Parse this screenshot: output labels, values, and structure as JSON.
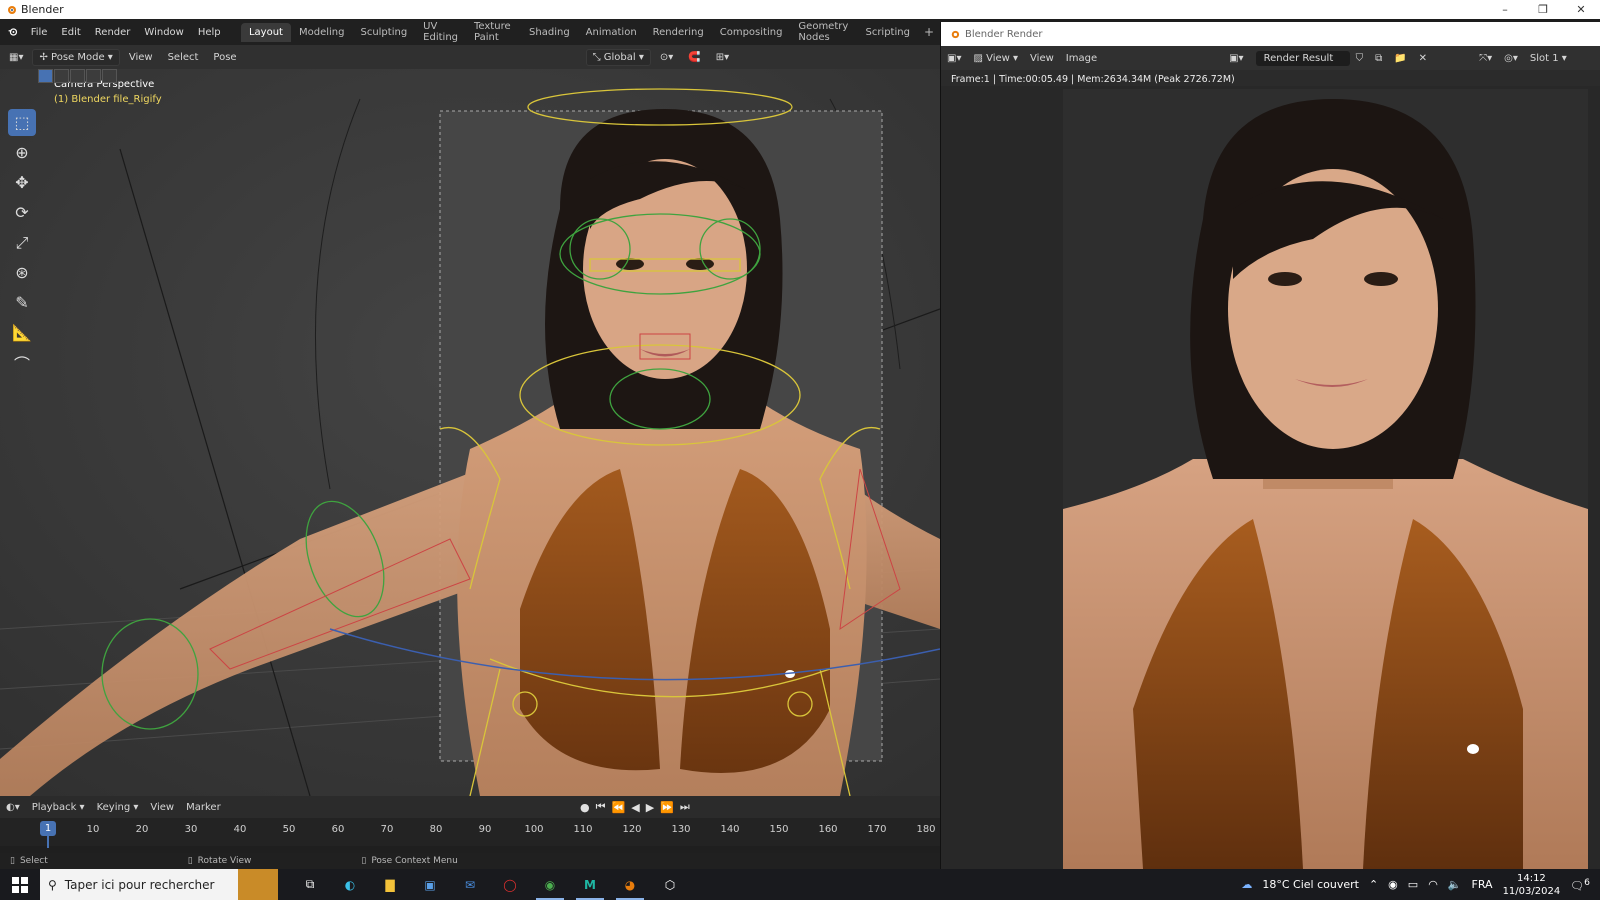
{
  "os": {
    "window_title": "Blender",
    "min": "–",
    "max": "❐",
    "close": "✕"
  },
  "topbar": {
    "menus": [
      "File",
      "Edit",
      "Render",
      "Window",
      "Help"
    ],
    "tabs": [
      "Layout",
      "Modeling",
      "Sculpting",
      "UV Editing",
      "Texture Paint",
      "Shading",
      "Animation",
      "Rendering",
      "Compositing",
      "Geometry Nodes",
      "Scripting"
    ],
    "active_tab": "Layout",
    "add_tab": "+"
  },
  "viewport_header": {
    "mode": "Pose Mode",
    "menus": [
      "View",
      "Select",
      "Pose"
    ],
    "orientation": "Global"
  },
  "viewport": {
    "info_line1": "Camera Perspective",
    "info_line2": "(1) Blender file_Rigify"
  },
  "tools": [
    "select-box",
    "cursor",
    "move",
    "rotate",
    "scale",
    "transform",
    "annotate",
    "measure",
    "bone-envelope"
  ],
  "timeline": {
    "menus": [
      "Playback",
      "Keying",
      "View",
      "Marker"
    ],
    "current_frame": "1",
    "ticks": [
      "10",
      "20",
      "30",
      "40",
      "50",
      "60",
      "70",
      "80",
      "90",
      "100",
      "110",
      "120",
      "130",
      "140",
      "150",
      "160",
      "170",
      "180"
    ]
  },
  "statusbar": {
    "left": "Select",
    "middle": "Rotate View",
    "right": "Pose Context Menu"
  },
  "render_window": {
    "title": "Blender Render",
    "menus": [
      "View",
      "View",
      "Image"
    ],
    "image_name": "Render Result",
    "slot": "Slot 1",
    "stats": "Frame:1 | Time:00:05.49 | Mem:2634.34M (Peak 2726.72M)"
  },
  "taskbar": {
    "search_placeholder": "Taper ici pour rechercher",
    "weather": "18°C  Ciel couvert",
    "lang": "FRA",
    "time": "14:12",
    "date": "11/03/2024",
    "notif_count": "6"
  },
  "colors": {
    "accent": "#4772b3",
    "rig_yellow": "#d9c53a",
    "rig_green": "#3fa33f",
    "bikini": "#8a4a17",
    "skin": "#c9926d"
  }
}
